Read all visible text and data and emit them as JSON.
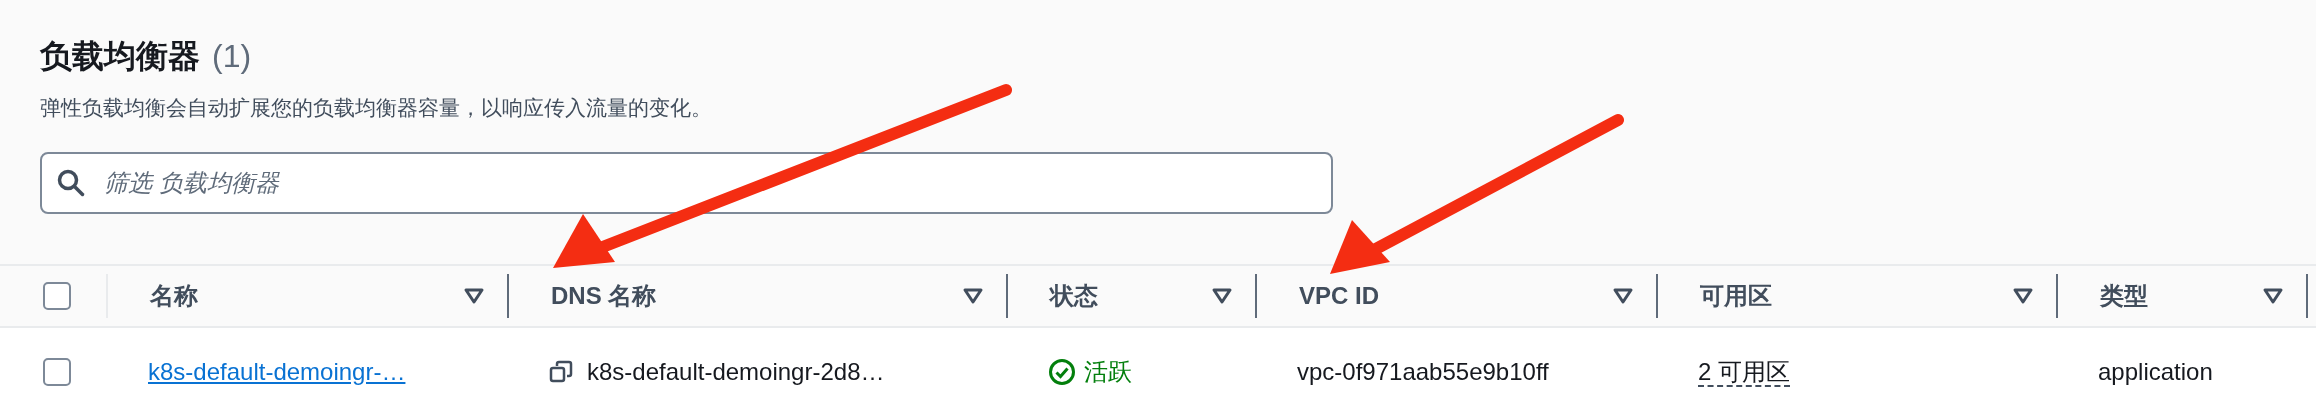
{
  "header": {
    "title": "负载均衡器",
    "count": "(1)",
    "description": "弹性负载均衡会自动扩展您的负载均衡器容量，以响应传入流量的变化。"
  },
  "search": {
    "placeholder": "筛选 负载均衡器"
  },
  "table": {
    "select_all": {
      "checked": false
    },
    "columns": [
      {
        "label": "名称"
      },
      {
        "label": "DNS 名称"
      },
      {
        "label": "状态"
      },
      {
        "label": "VPC ID"
      },
      {
        "label": "可用区"
      },
      {
        "label": "类型"
      }
    ],
    "rows": [
      {
        "checked": false,
        "name": "k8s-default-demoingr-…",
        "dns": "k8s-default-demoingr-2d8…",
        "status": {
          "text": "活跃",
          "kind": "active"
        },
        "vpc": "vpc-0f971aab55e9b10ff",
        "zones": "2 可用区",
        "type": "application"
      }
    ]
  }
}
